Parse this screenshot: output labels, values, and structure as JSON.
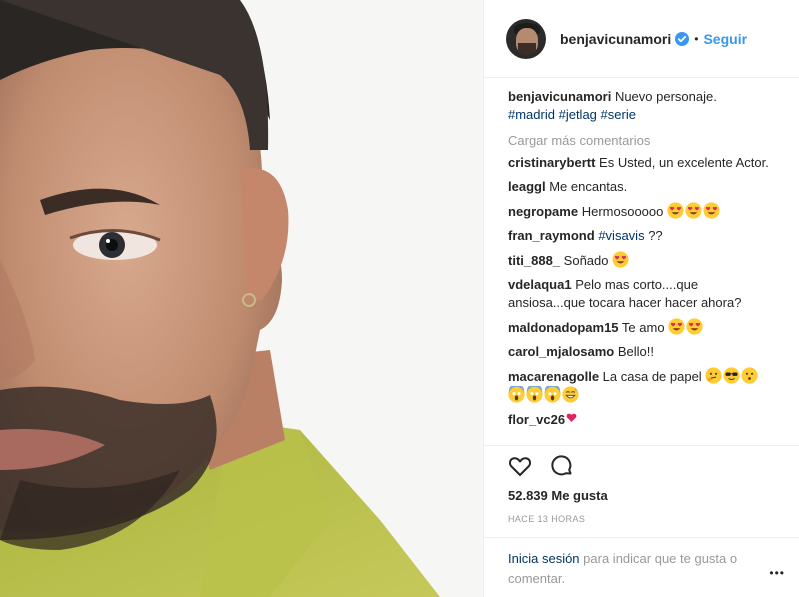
{
  "post": {
    "username": "benjavicunamori",
    "follow_label": "Seguir",
    "dot": "•",
    "caption_user": "benjavicunamori",
    "caption_text": "Nuevo personaje.",
    "hashtags": [
      "#madrid",
      "#jetlag",
      "#serie"
    ],
    "load_more": "Cargar más comentarios",
    "likes": "52.839 Me gusta",
    "time": "HACE 13 HORAS",
    "login_link": "Inicia sesión",
    "login_text": "para indicar que te gusta o comentar.",
    "more_icon": "•••"
  },
  "comments": [
    {
      "user": "cristinarybertt",
      "text": "Es Usted, un excelente Actor."
    },
    {
      "user": "leaggl",
      "text": "Me encantas."
    },
    {
      "user": "negropame",
      "text": "Hermosooooo",
      "emojis": [
        "heart-eyes",
        "heart-eyes",
        "heart-eyes"
      ]
    },
    {
      "user": "fran_raymond",
      "tag": "#visavis",
      "text": "??"
    },
    {
      "user": "titi_888_",
      "text": "Soñado",
      "emojis": [
        "heart-eyes"
      ]
    },
    {
      "user": "vdelaqua1",
      "text": "Pelo mas corto....que ansiosa...que tocara hacer hacer ahora?"
    },
    {
      "user": "maldonadopam15",
      "text": "Te amo",
      "emojis": [
        "heart-eyes",
        "heart-eyes"
      ]
    },
    {
      "user": "carol_mjalosamo",
      "text": "Bello!!"
    },
    {
      "user": "macarenagolle",
      "text": "La casa de papel",
      "emojis": [
        "thinking",
        "sunglasses",
        "neutral",
        "scream",
        "scream",
        "scream",
        "smile-sweat"
      ]
    },
    {
      "user": "flor_vc26",
      "text": "",
      "emojis": [
        "heart"
      ]
    }
  ],
  "colors": {
    "link_blue": "#3897f0",
    "hashtag_navy": "#003569",
    "muted_gray": "#999999",
    "text": "#262626"
  }
}
